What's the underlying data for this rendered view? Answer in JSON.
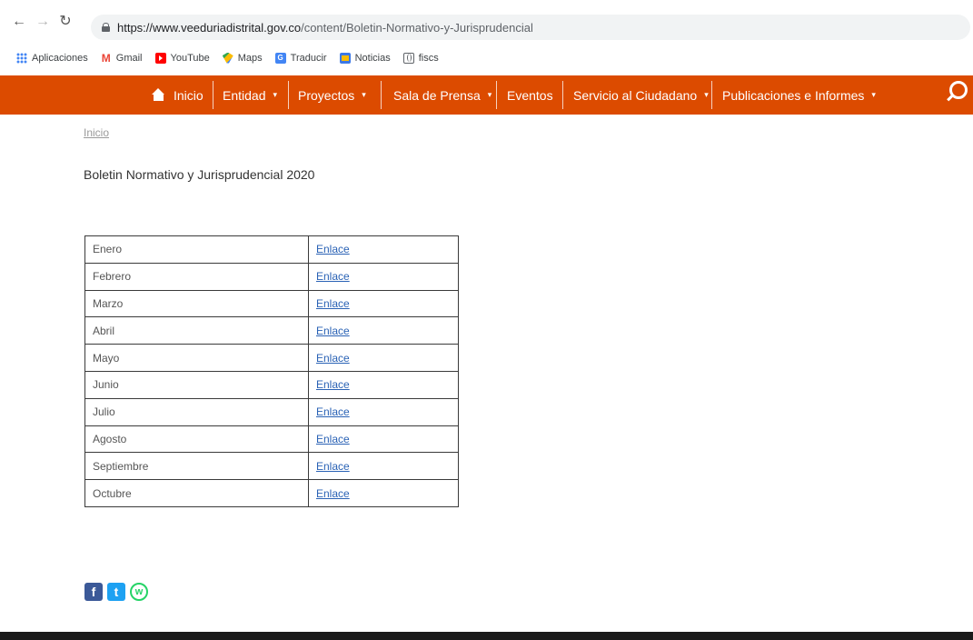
{
  "browser": {
    "url_host": "https://www.veeduriadistrital.gov.co",
    "url_path": "/content/Boletin-Normativo-y-Jurisprudencial",
    "bookmarks": [
      {
        "label": "Aplicaciones",
        "icon": "apps-grid-icon"
      },
      {
        "label": "Gmail",
        "icon": "gmail-icon"
      },
      {
        "label": "YouTube",
        "icon": "youtube-icon"
      },
      {
        "label": "Maps",
        "icon": "maps-icon"
      },
      {
        "label": "Traducir",
        "icon": "translate-icon"
      },
      {
        "label": "Noticias",
        "icon": "news-icon"
      },
      {
        "label": "fiscs",
        "icon": "globe-icon"
      }
    ]
  },
  "nav": {
    "inicio": "Inicio",
    "entidad": "Entidad",
    "proyectos": "Proyectos",
    "sala": "Sala de Prensa",
    "eventos": "Eventos",
    "servicio": "Servicio al Ciudadano",
    "publicaciones": "Publicaciones e Informes",
    "caret": "▾",
    "accent_color": "#dc4b00"
  },
  "breadcrumb": "Inicio",
  "page_title": "Boletin Normativo y Jurisprudencial 2020",
  "table": {
    "rows": [
      {
        "month": "Enero",
        "link": "Enlace"
      },
      {
        "month": "Febrero",
        "link": "Enlace"
      },
      {
        "month": "Marzo",
        "link": "Enlace"
      },
      {
        "month": "Abril",
        "link": "Enlace"
      },
      {
        "month": "Mayo",
        "link": "Enlace"
      },
      {
        "month": "Junio",
        "link": "Enlace"
      },
      {
        "month": "Julio",
        "link": "Enlace"
      },
      {
        "month": "Agosto",
        "link": "Enlace"
      },
      {
        "month": "Septiembre",
        "link": "Enlace"
      },
      {
        "month": "Octubre",
        "link": "Enlace"
      }
    ]
  },
  "social": {
    "facebook": "f",
    "twitter": "t",
    "whatsapp": "w"
  }
}
